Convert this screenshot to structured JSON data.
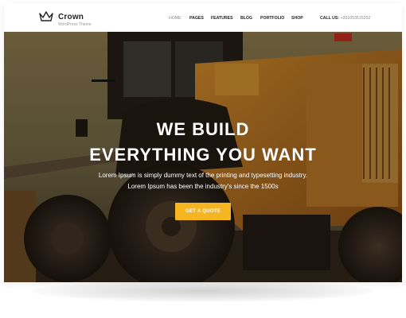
{
  "brand": {
    "name": "Crown",
    "tagline": "WordPress Theme",
    "icon": "crown-icon"
  },
  "nav": {
    "items": [
      "HOME",
      "PAGES",
      "FEATURES",
      "BLOG",
      "PORTFOLIO",
      "SHOP"
    ],
    "active": "HOME",
    "call_label": "CALL US:",
    "call_number": "+201053515252"
  },
  "hero": {
    "headline_line1": "WE BUILD",
    "headline_line2": "EVERYTHING YOU WANT",
    "subtext_line1": "Lorem Ipsum is simply dummy text of the printing and typesetting industry.",
    "subtext_line2": "Lorem Ipsum has been the industry's since the 1500s",
    "cta_label": "GET A QUOTE",
    "background": "construction-loader-photo"
  },
  "colors": {
    "accent": "#f5b520",
    "text_dark": "#222222",
    "text_muted": "#888888"
  }
}
